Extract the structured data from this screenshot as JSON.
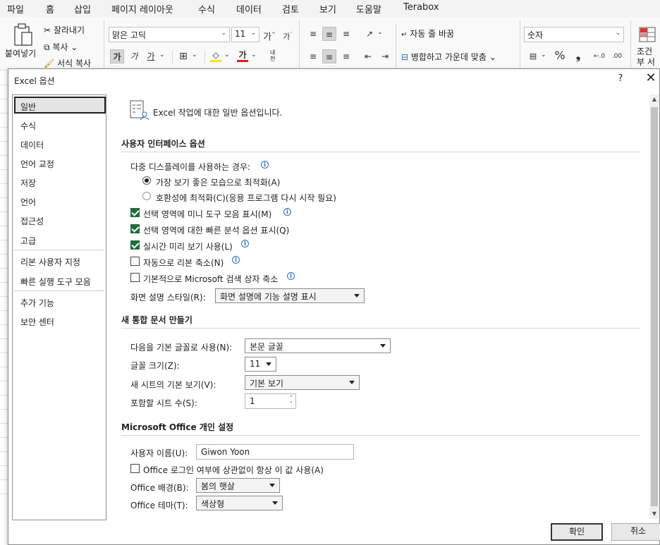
{
  "ribbon": {
    "tabs": [
      "파일",
      "홈",
      "삽입",
      "페이지 레이아웃",
      "수식",
      "데이터",
      "검토",
      "보기",
      "도움말",
      "Terabox"
    ],
    "active_tab": "홈",
    "clipboard": {
      "paste": "붙여넣기",
      "cut": "잘라내기",
      "copy": "복사",
      "format_painter": "서식 복사"
    },
    "font": {
      "name": "맑은 고딕",
      "size": "11",
      "grow": "가",
      "shrink": "가",
      "bold": "가",
      "italic": "가",
      "underline": "가",
      "font_color": "가",
      "phonetic": "내천"
    },
    "alignment": {
      "wrap_text": "자동 줄 바꿈",
      "merge_center": "병합하고 가운데 맞춤"
    },
    "number": {
      "format": "숫자",
      "percent": "%",
      "comma": "❟"
    },
    "styles": {
      "conditional": "조건부 서식"
    }
  },
  "dialog": {
    "title": "Excel 옵션",
    "help": "?",
    "close": "✕",
    "nav": [
      "일반",
      "수식",
      "데이터",
      "언어 교정",
      "저장",
      "언어",
      "접근성",
      "고급",
      "리본 사용자 지정",
      "빠른 실행 도구 모음",
      "추가 기능",
      "보안 센터"
    ],
    "selected_nav": "일반",
    "header_text": "Excel 작업에 대한 일반 옵션입니다.",
    "ui_section": {
      "heading": "사용자 인터페이스 옵션",
      "multi_display_label": "다중 디스플레이를 사용하는 경우:",
      "radio_best": "가장 보기 좋은 모습으로 최적화(A)",
      "radio_compat": "호환성에 최적화(C)(응용 프로그램 다시 시작 필요)",
      "mini_toolbar": "선택 영역에 미니 도구 모음 표시(M)",
      "quick_analysis": "선택 영역에 대한 빠른 분석 옵션 표시(Q)",
      "live_preview": "실시간 미리 보기 사용(L)",
      "collapse_ribbon": "자동으로 리본 축소(N)",
      "collapse_search": "기본적으로 Microsoft 검색 상자 축소",
      "screentip_label": "화면 설명 스타일(R):",
      "screentip_value": "화면 설명에 기능 설명 표시"
    },
    "new_workbook": {
      "heading": "새 통합 문서 만들기",
      "font_label": "다음을 기본 글꼴로 사용(N):",
      "font_value": "본문 글꼴",
      "size_label": "글꼴 크기(Z):",
      "size_value": "11",
      "view_label": "새 시트의 기본 보기(V):",
      "view_value": "기본 보기",
      "sheets_label": "포함할 시트 수(S):",
      "sheets_value": "1"
    },
    "personalize": {
      "heading": "Microsoft Office 개인 설정",
      "username_label": "사용자 이름(U):",
      "username_value": "Giwon Yoon",
      "always_use": "Office 로그인 여부에 상관없이 항상 이 값 사용(A)",
      "background_label": "Office 배경(B):",
      "background_value": "봄의 햇살",
      "theme_label": "Office 테마(T):",
      "theme_value": "색상형"
    },
    "ok": "확인",
    "cancel": "취소"
  }
}
